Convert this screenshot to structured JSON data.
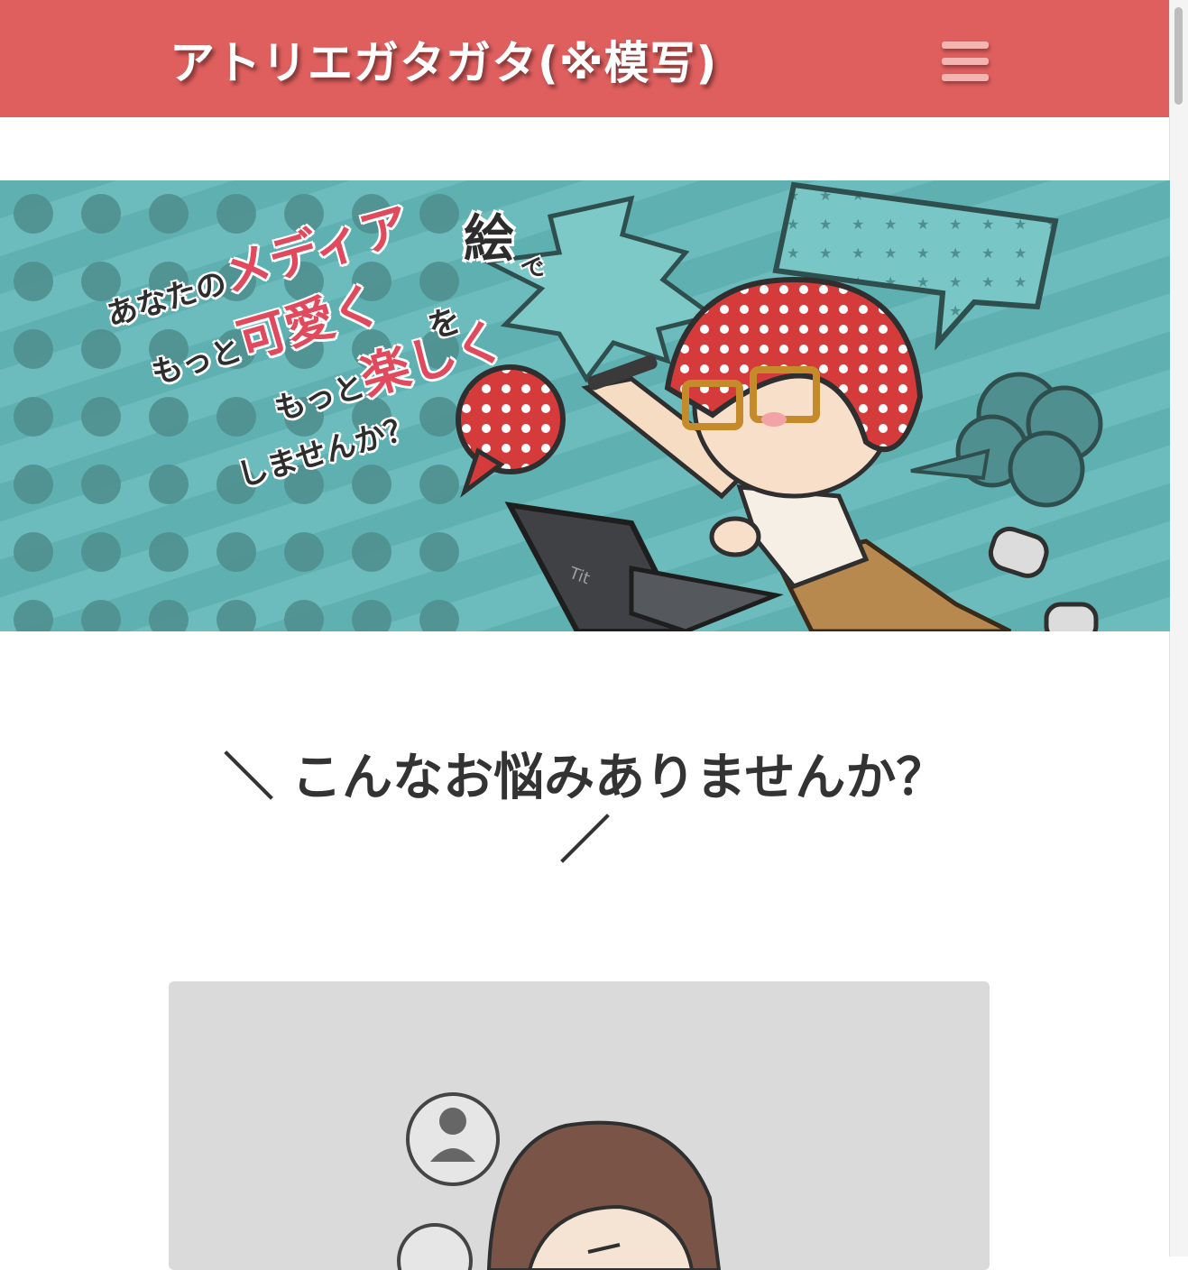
{
  "header": {
    "site_title": "アトリエガタガタ(※模写)",
    "menu_icon": "hamburger-menu-icon",
    "background_color": "#df5f5e"
  },
  "hero": {
    "speech_badge": "絵",
    "badge_suffix": "で",
    "line1_prefix": "あなたの",
    "line1_accent": "メディア",
    "line1_suffix": "を",
    "line2_prefix": "もっと",
    "line2_accent": "可愛く",
    "line3_prefix": "もっと",
    "line3_accent": "楽しく",
    "line4": "しませんか？",
    "background_color": "#67b8b9",
    "accent_color": "#e04a5c"
  },
  "section": {
    "title_line1": "＼ こんなお悩みありませんか？",
    "title_line2": "／"
  },
  "card": {
    "background_color": "#dadada",
    "icons": [
      "user-icon",
      "user-icon"
    ]
  }
}
